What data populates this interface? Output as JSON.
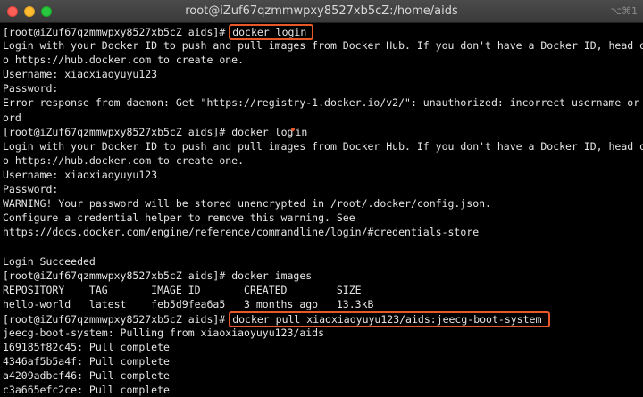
{
  "window": {
    "title": "root@iZuf67qzmmwpxy8527xb5cZ:/home/aids",
    "shortcut": "⌥⌘1"
  },
  "terminal": {
    "prompt": "[root@iZuf67qzmmwpxy8527xb5cZ aids]# ",
    "lines": [
      {
        "kind": "cmd-boxed",
        "command": "docker login"
      },
      {
        "kind": "text",
        "text": "Login with your Docker ID to push and pull images from Docker Hub. If you don't have a Docker ID, head over t"
      },
      {
        "kind": "text",
        "text": "o https://hub.docker.com to create one."
      },
      {
        "kind": "text",
        "text": "Username: xiaoxiaoyuyu123"
      },
      {
        "kind": "text",
        "text": "Password:"
      },
      {
        "kind": "text",
        "text": "Error response from daemon: Get \"https://registry-1.docker.io/v2/\": unauthorized: incorrect username or passw"
      },
      {
        "kind": "text",
        "text": "ord"
      },
      {
        "kind": "cmd-dot",
        "command": "docker login"
      },
      {
        "kind": "text",
        "text": "Login with your Docker ID to push and pull images from Docker Hub. If you don't have a Docker ID, head over t"
      },
      {
        "kind": "text",
        "text": "o https://hub.docker.com to create one."
      },
      {
        "kind": "text",
        "text": "Username: xiaoxiaoyuyu123"
      },
      {
        "kind": "text",
        "text": "Password:"
      },
      {
        "kind": "text",
        "text": "WARNING! Your password will be stored unencrypted in /root/.docker/config.json."
      },
      {
        "kind": "text",
        "text": "Configure a credential helper to remove this warning. See"
      },
      {
        "kind": "text",
        "text": "https://docs.docker.com/engine/reference/commandline/login/#credentials-store"
      },
      {
        "kind": "text",
        "text": ""
      },
      {
        "kind": "text",
        "text": "Login Succeeded"
      },
      {
        "kind": "cmd",
        "command": "docker images"
      },
      {
        "kind": "text",
        "text": "REPOSITORY    TAG       IMAGE ID       CREATED        SIZE"
      },
      {
        "kind": "text",
        "text": "hello-world   latest    feb5d9fea6a5   3 months ago   13.3kB"
      },
      {
        "kind": "cmd-boxed-big",
        "command": "docker pull xiaoxiaoyuyu123/aids:jeecg-boot-system"
      },
      {
        "kind": "text",
        "text": "jeecg-boot-system: Pulling from xiaoxiaoyuyu123/aids"
      },
      {
        "kind": "text",
        "text": "169185f82c45: Pull complete"
      },
      {
        "kind": "text",
        "text": "4346af5b5a4f: Pull complete"
      },
      {
        "kind": "text",
        "text": "a4209adbcf46: Pull complete"
      },
      {
        "kind": "text",
        "text": "c3a665efc2ce: Pull complete"
      }
    ]
  }
}
